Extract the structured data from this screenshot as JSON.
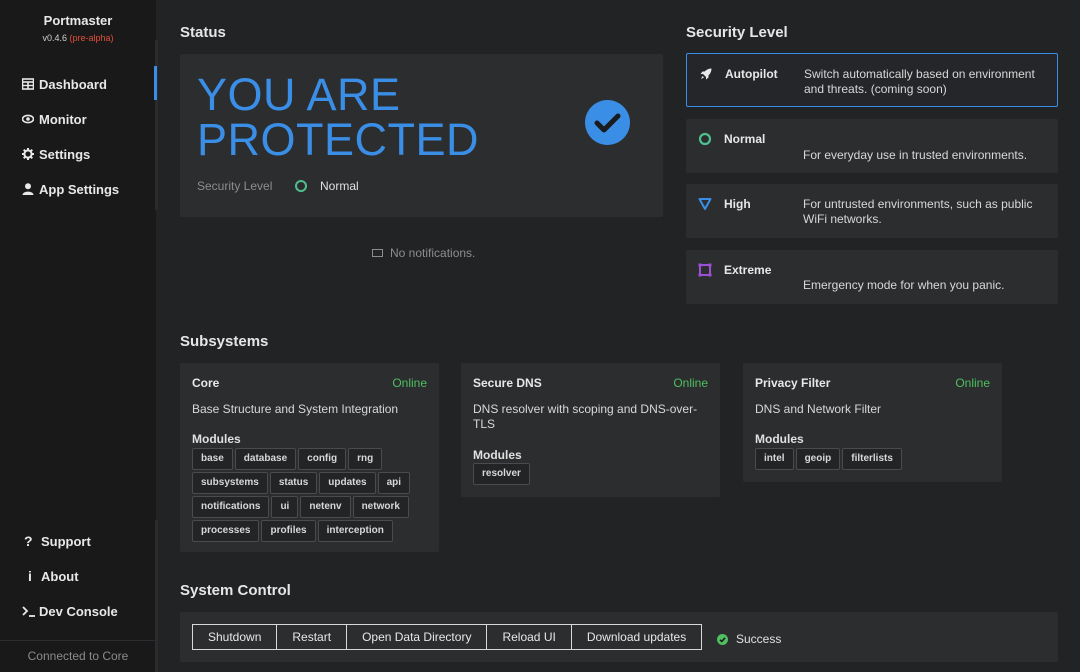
{
  "brand": {
    "name": "Portmaster",
    "version": "v0.4.6",
    "channel": "(pre-alpha)"
  },
  "nav": {
    "dashboard": "Dashboard",
    "monitor": "Monitor",
    "settings": "Settings",
    "app_settings": "App Settings",
    "support": "Support",
    "about": "About",
    "dev_console": "Dev Console"
  },
  "connection_status": "Connected to Core",
  "status": {
    "title": "Status",
    "headline_line1": "YOU ARE",
    "headline_line2": "PROTECTED",
    "security_level_label": "Security Level",
    "security_level_value": "Normal",
    "notifications": "No notifications."
  },
  "security_levels": {
    "title": "Security Level",
    "autopilot": {
      "name": "Autopilot",
      "desc": "Switch automatically based on environment and threats. (coming soon)",
      "icon": "rocket-icon"
    },
    "normal": {
      "name": "Normal",
      "desc": "For everyday use in trusted environments.",
      "icon": "circle-icon"
    },
    "high": {
      "name": "High",
      "desc": "For untrusted environments, such as public WiFi networks.",
      "icon": "triangle-icon"
    },
    "extreme": {
      "name": "Extreme",
      "desc": "Emergency mode for when you panic.",
      "icon": "square-icon"
    }
  },
  "subsystems": {
    "title": "Subsystems",
    "modules_label": "Modules",
    "core": {
      "name": "Core",
      "status": "Online",
      "desc": "Base Structure and System Integration",
      "modules": [
        "base",
        "database",
        "config",
        "rng",
        "subsystems",
        "status",
        "updates",
        "api",
        "notifications",
        "ui",
        "netenv",
        "network",
        "processes",
        "profiles",
        "interception"
      ]
    },
    "dns": {
      "name": "Secure DNS",
      "status": "Online",
      "desc": "DNS resolver with scoping and DNS-over-TLS",
      "modules": [
        "resolver"
      ]
    },
    "privacy": {
      "name": "Privacy Filter",
      "status": "Online",
      "desc": "DNS and Network Filter",
      "modules": [
        "intel",
        "geoip",
        "filterlists"
      ]
    }
  },
  "system_control": {
    "title": "System Control",
    "shutdown": "Shutdown",
    "restart": "Restart",
    "open_data_dir": "Open Data Directory",
    "reload_ui": "Reload UI",
    "download_updates": "Download updates",
    "result": "Success"
  },
  "colors": {
    "accent": "#3a8ee6",
    "online": "#4fbf5f",
    "normal": "#4fbf8f",
    "extreme": "#9b4fd6"
  }
}
